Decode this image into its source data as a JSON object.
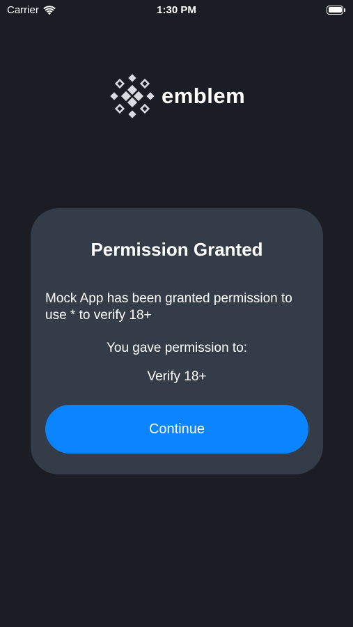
{
  "status_bar": {
    "carrier": "Carrier",
    "time": "1:30 PM"
  },
  "logo": {
    "text": "emblem",
    "icon": "emblem-logo-icon"
  },
  "card": {
    "title": "Permission Granted",
    "message": "Mock App has been granted permission to use * to verify 18+",
    "subhead": "You gave permission to:",
    "permission": "Verify 18+",
    "continue_label": "Continue"
  },
  "colors": {
    "background": "#1b1d24",
    "card": "#343c48",
    "accent": "#0a84ff",
    "text": "#ffffff"
  }
}
